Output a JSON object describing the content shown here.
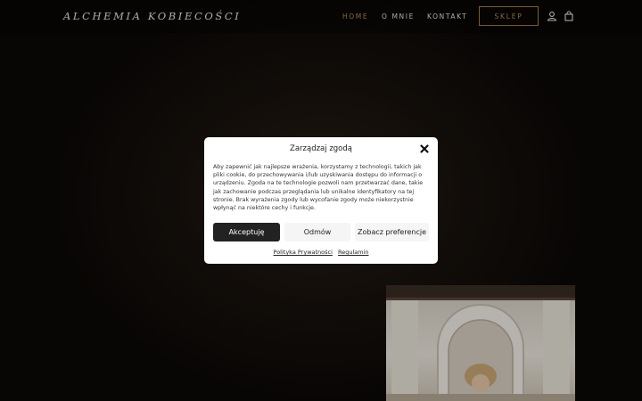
{
  "header": {
    "logo": "ALCHEMIA KOBIECOŚCI",
    "nav": [
      {
        "label": "HOME",
        "active": true
      },
      {
        "label": "O MNIE",
        "active": false
      },
      {
        "label": "KONTAKT",
        "active": false
      }
    ],
    "shop_label": "SKLEP",
    "icons": [
      "user-icon",
      "shopping-bag-icon"
    ]
  },
  "modal": {
    "title": "Zarządzaj zgodą",
    "body": "Aby zapewnić jak najlepsze wrażenia, korzystamy z technologii, takich jak pliki cookie, do przechowywania i/lub uzyskiwania dostępu do informacji o urządzeniu. Zgoda na te technologie pozwoli nam przetwarzać dane, takie jak zachowanie podczas przeglądania lub unikalne identyfikatory na tej stronie. Brak wyrażenia zgody lub wycofanie zgody może niekorzystnie wpłynąć na niektóre cechy i funkcje.",
    "buttons": {
      "accept": "Akceptuję",
      "deny": "Odmów",
      "preferences": "Zobacz preferencje"
    },
    "links": {
      "privacy": "Polityka Prywatności",
      "terms": "Regulamin"
    },
    "close_icon": "close-icon"
  },
  "colors": {
    "accent": "#b98a55",
    "background": "#0b0806",
    "modal_bg": "#ffffff",
    "accept_bg": "#222222"
  }
}
